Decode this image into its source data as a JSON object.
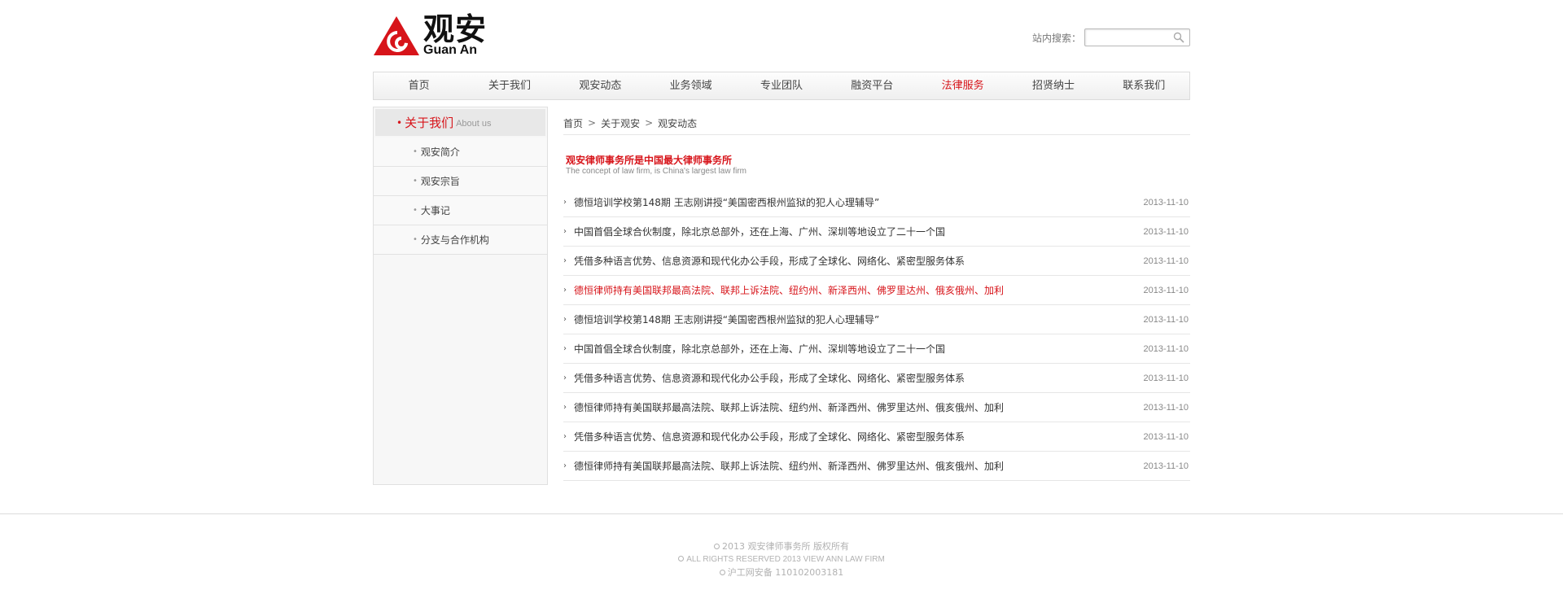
{
  "brand": {
    "name_cn": "观安",
    "name_en": "Guan An",
    "red": "#d7141a"
  },
  "search": {
    "label": "站内搜索：",
    "value": "",
    "placeholder": ""
  },
  "nav": {
    "items": [
      {
        "label": "首页"
      },
      {
        "label": "关于我们"
      },
      {
        "label": "观安动态"
      },
      {
        "label": "业务领域"
      },
      {
        "label": "专业团队"
      },
      {
        "label": "融资平台"
      },
      {
        "label": "法律服务"
      },
      {
        "label": "招贤纳士"
      },
      {
        "label": "联系我们"
      }
    ],
    "active_index": 6
  },
  "sidebar": {
    "title_cn": "关于我们",
    "title_en": "About us",
    "items": [
      {
        "label": "观安简介"
      },
      {
        "label": "观安宗旨"
      },
      {
        "label": "大事记"
      },
      {
        "label": "分支与合作机构"
      }
    ]
  },
  "breadcrumb": [
    "首页",
    "关于观安",
    "观安动态"
  ],
  "section": {
    "title_cn": "观安律师事务所是中国最大律师事务所",
    "title_en": "The concept of law firm, is China's largest law firm"
  },
  "articles": [
    {
      "title": "德恒培训学校第148期 王志刚讲授“美国密西根州监狱的犯人心理辅导”",
      "date": "2013-11-10"
    },
    {
      "title": "中国首倡全球合伙制度，除北京总部外，还在上海、广州、深圳等地设立了二十一个国",
      "date": "2013-11-10"
    },
    {
      "title": "凭借多种语言优势、信息资源和现代化办公手段，形成了全球化、网络化、紧密型服务体系",
      "date": "2013-11-10"
    },
    {
      "title": "德恒律师持有美国联邦最高法院、联邦上诉法院、纽约州、新泽西州、佛罗里达州、俄亥俄州、加利",
      "date": "2013-11-10"
    },
    {
      "title": "德恒培训学校第148期 王志刚讲授“美国密西根州监狱的犯人心理辅导”",
      "date": "2013-11-10"
    },
    {
      "title": "中国首倡全球合伙制度，除北京总部外，还在上海、广州、深圳等地设立了二十一个国",
      "date": "2013-11-10"
    },
    {
      "title": "凭借多种语言优势、信息资源和现代化办公手段，形成了全球化、网络化、紧密型服务体系",
      "date": "2013-11-10"
    },
    {
      "title": "德恒律师持有美国联邦最高法院、联邦上诉法院、纽约州、新泽西州、佛罗里达州、俄亥俄州、加利",
      "date": "2013-11-10"
    },
    {
      "title": "凭借多种语言优势、信息资源和现代化办公手段，形成了全球化、网络化、紧密型服务体系",
      "date": "2013-11-10"
    },
    {
      "title": "德恒律师持有美国联邦最高法院、联邦上诉法院、纽约州、新泽西州、佛罗里达州、俄亥俄州、加利",
      "date": "2013-11-10"
    }
  ],
  "highlighted_article_index": 3,
  "footer": {
    "copyright": "2013  观安律师事务所  版权所有",
    "rights_en": "ALL RIGHTS RESERVED 2013 VIEW ANN LAW FIRM",
    "icp": "沪工网安备  110102003181"
  }
}
